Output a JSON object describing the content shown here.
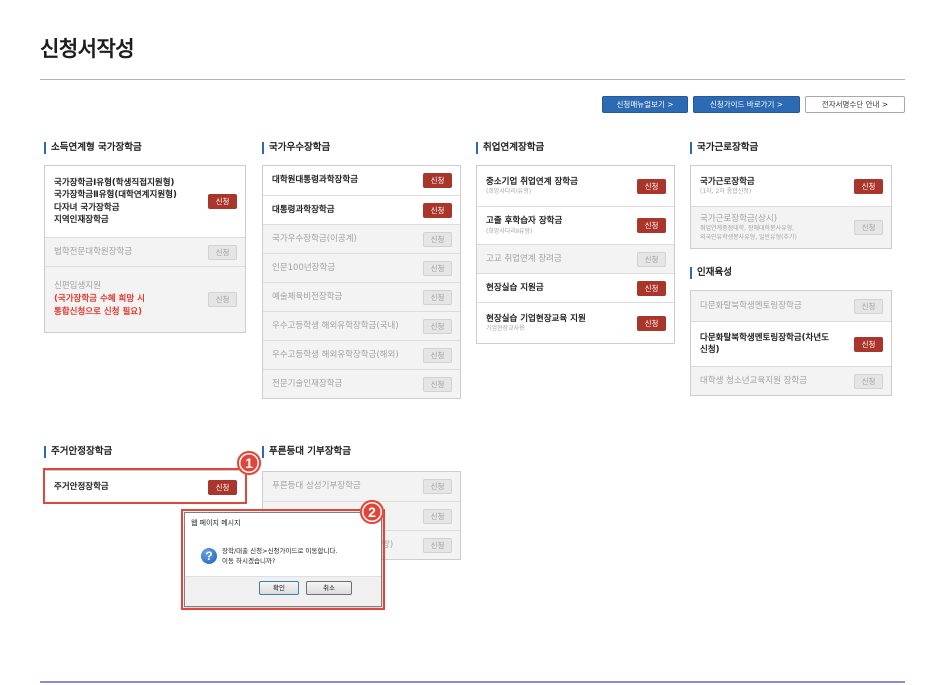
{
  "page": {
    "title": "신청서작성"
  },
  "top_buttons": {
    "manual": "신청매뉴얼보기 >",
    "guide": "신청가이드 바로가기 >",
    "signature": "전자서명수단 안내 >"
  },
  "sections": [
    {
      "title": "소득연계형 국가장학금",
      "items": [
        {
          "lines": [
            "국가장학금Ⅰ유형(학생직접지원형)",
            "국가장학금Ⅱ유형(대학연계지원형)",
            "다자녀 국가장학금",
            "지역인재장학금"
          ],
          "button": "신청",
          "active": true
        },
        {
          "lines": [
            "법학전문대학원장학금"
          ],
          "button": "신청",
          "active": false
        },
        {
          "lines": [
            "신편입생지원"
          ],
          "notes": [
            "(국가장학금 수혜 희망 시",
            "통합신청으로 신청 필요)"
          ],
          "button": "신청",
          "active": false
        }
      ]
    },
    {
      "title": "국가우수장학금",
      "items": [
        {
          "lines": [
            "대학원대통령과학장학금"
          ],
          "button": "신청",
          "active": true
        },
        {
          "lines": [
            "대통령과학장학금"
          ],
          "button": "신청",
          "active": true
        },
        {
          "lines": [
            "국가우수장학금(이공계)"
          ],
          "button": "신청",
          "active": false
        },
        {
          "lines": [
            "인문100년장학금"
          ],
          "button": "신청",
          "active": false
        },
        {
          "lines": [
            "예술체육비전장학금"
          ],
          "button": "신청",
          "active": false
        },
        {
          "lines": [
            "우수고등학생 해외유학장학금(국내)"
          ],
          "button": "신청",
          "active": false
        },
        {
          "lines": [
            "우수고등학생 해외유학장학금(해외)"
          ],
          "button": "신청",
          "active": false
        },
        {
          "lines": [
            "전문기술인재장학금"
          ],
          "button": "신청",
          "active": false
        }
      ]
    },
    {
      "title": "취업연계장학금",
      "items": [
        {
          "lines": [
            "중소기업 취업연계 장학금"
          ],
          "sub": [
            "(희망사다리Ⅰ유형)"
          ],
          "button": "신청",
          "active": true
        },
        {
          "lines": [
            "고졸 후학습자 장학금"
          ],
          "sub": [
            "(희망사다리Ⅱ유형)"
          ],
          "button": "신청",
          "active": true
        },
        {
          "lines": [
            "고교 취업연계 장려금"
          ],
          "button": "신청",
          "active": false
        },
        {
          "lines": [
            "현장실습 지원금"
          ],
          "button": "신청",
          "active": true
        },
        {
          "lines": [
            "현장실습 기업현장교육 지원"
          ],
          "sub": [
            "기업현장교사용"
          ],
          "button": "신청",
          "active": true
        }
      ]
    },
    {
      "title": "국가근로장학금",
      "items": [
        {
          "lines": [
            "국가근로장학금"
          ],
          "sub": [
            "(1차, 2차 통합신청)"
          ],
          "button": "신청",
          "active": true
        },
        {
          "lines": [
            "국가근로장학금(상시)"
          ],
          "sub": [
            "취업연계중점대학, 장애대학봉사유형,",
            "외국인유학생봉사유형, 일반유형(추가)"
          ],
          "button": "신청",
          "active": false
        }
      ]
    },
    {
      "title": "인재육성",
      "items": [
        {
          "lines": [
            "다문화탈북학생멘토링장학금"
          ],
          "button": "신청",
          "active": false
        },
        {
          "lines": [
            "다문화탈북학생멘토링장학금(차년도",
            "신청)"
          ],
          "button": "신청",
          "active": true
        },
        {
          "lines": [
            "대학생 청소년교육지원 장학금"
          ],
          "button": "신청",
          "active": false
        }
      ]
    },
    {
      "title": "주거안정장학금",
      "items": [
        {
          "lines": [
            "주거안정장학금"
          ],
          "button": "신청",
          "active": true
        }
      ]
    },
    {
      "title": "푸른등대 기부장학금",
      "items": [
        {
          "lines": [
            "푸른등대 삼성기부장학금"
          ],
          "button": "신청",
          "active": false
        },
        {
          "lines": [],
          "button": "신청",
          "active": false
        },
        {
          "lines": [
            "방)"
          ],
          "button": "신청",
          "active": false
        }
      ]
    }
  ],
  "dialog": {
    "title": "웹 페이지 메시지",
    "icon": "question-icon",
    "icon_glyph": "?",
    "message": [
      "장학/대출 신청>신청가이드로 이동합니다.",
      "이동 하시겠습니까?"
    ],
    "ok": "확인",
    "cancel": "취소"
  },
  "annotations": [
    {
      "label": "1"
    },
    {
      "label": "2"
    }
  ],
  "colors": {
    "primary_blue": "#2c6ab3",
    "apply_red": "#a9352b",
    "highlight_red": "#e2463a",
    "notice_red": "#e03a2e",
    "footer_rule": "#8b8ec9"
  }
}
